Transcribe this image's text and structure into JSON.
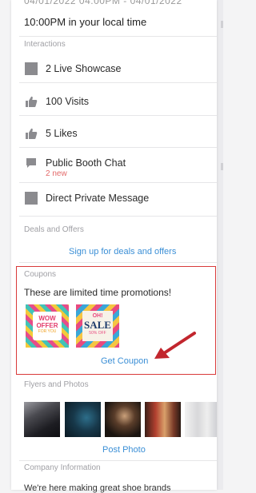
{
  "header": {
    "date_range": "04/01/2022 04:00PM - 04/01/2022",
    "local_time": "10:00PM in your local time"
  },
  "interactions": {
    "label": "Interactions",
    "items": [
      {
        "label": "2 Live Showcase",
        "icon": "showcase-icon"
      },
      {
        "label": "100 Visits",
        "icon": "thumbs-up-icon"
      },
      {
        "label": "5 Likes",
        "icon": "thumbs-up-icon"
      },
      {
        "label": "Public Booth Chat",
        "sub": "2 new",
        "icon": "chat-bubble-icon"
      },
      {
        "label": "Direct Private Message",
        "icon": "message-icon"
      }
    ]
  },
  "deals": {
    "label": "Deals and Offers",
    "link": "Sign up for deals and offers"
  },
  "coupons": {
    "label": "Coupons",
    "description": "These are limited time promotions!",
    "tile1": {
      "line1": "WOW",
      "line2": "OFFER",
      "line3": "FOR YOU"
    },
    "tile2": {
      "line1": "OH!",
      "line2": "SALE",
      "line3": "50% OFF"
    },
    "action": "Get Coupon",
    "highlight_color": "#d93a3a"
  },
  "flyers": {
    "label": "Flyers and Photos",
    "action": "Post Photo"
  },
  "company": {
    "label": "Company Information",
    "text": "We're here making great shoe brands"
  }
}
